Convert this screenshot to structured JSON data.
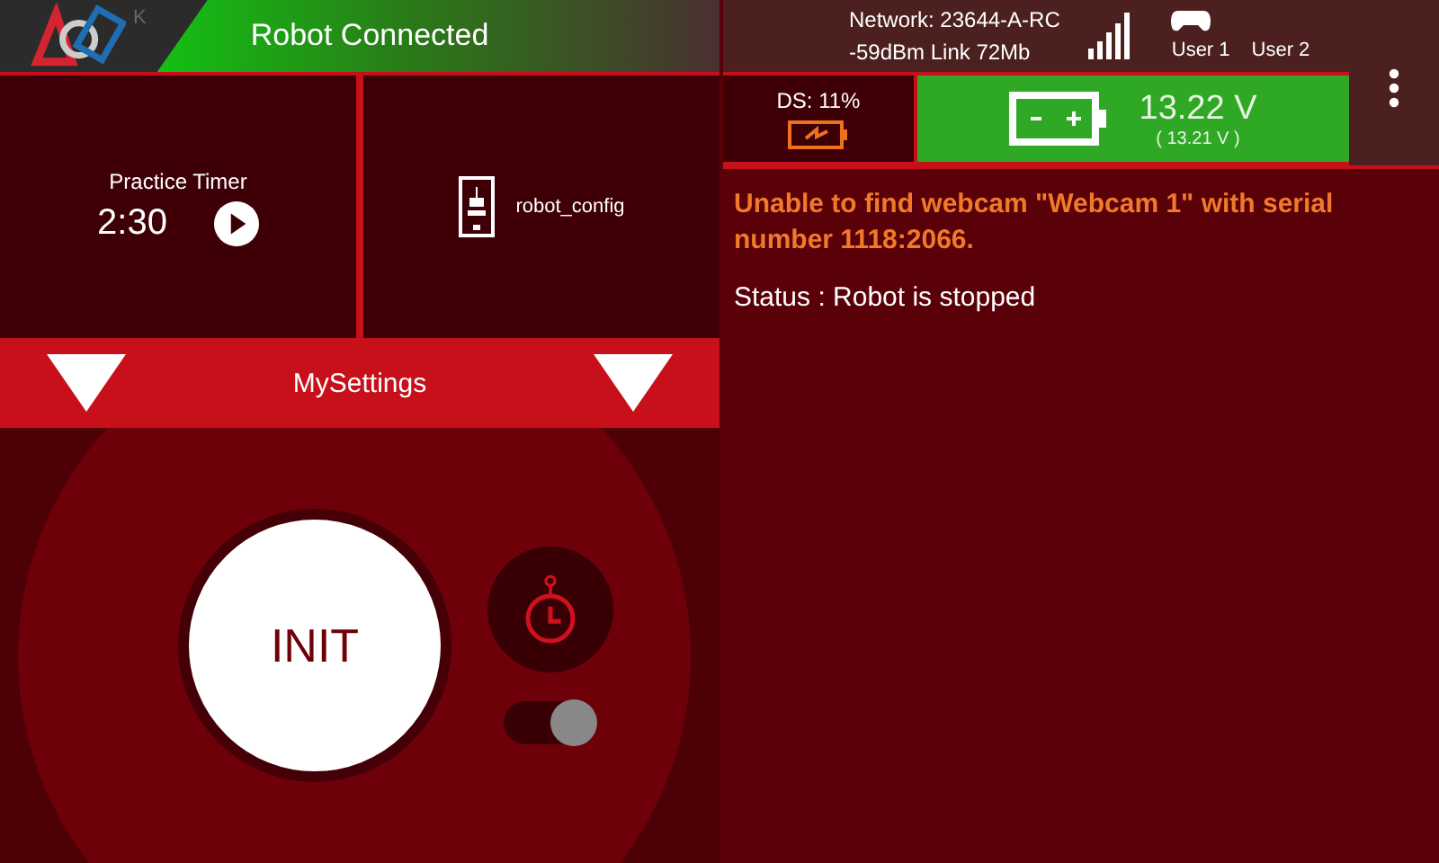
{
  "header": {
    "status": "Robot Connected",
    "faint_letter": "K",
    "network": "Network: 23644-A-RC",
    "link": "-59dBm Link 72Mb",
    "users": [
      "User 1",
      "User 2"
    ]
  },
  "ds": {
    "label": "DS: 11%"
  },
  "robot_battery": {
    "voltage": "13.22 V",
    "min_voltage": "( 13.21 V )"
  },
  "timer": {
    "label": "Practice Timer",
    "time": "2:30"
  },
  "config": {
    "name": "robot_config"
  },
  "opmode": {
    "name": "MySettings"
  },
  "init": {
    "label": "INIT"
  },
  "auto_timer_toggle": {
    "on": true
  },
  "messages": [
    {
      "kind": "error",
      "text": "Unable to find webcam \"Webcam 1\" with serial number 1118:2066."
    },
    {
      "kind": "status",
      "text": "Status : Robot is stopped"
    }
  ]
}
